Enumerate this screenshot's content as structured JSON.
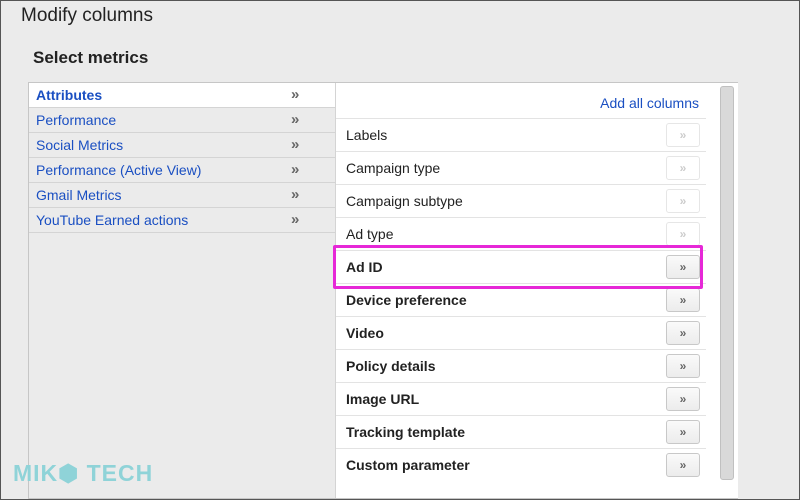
{
  "header": {
    "title": "Modify columns",
    "section_title": "Select metrics"
  },
  "categories": [
    {
      "label": "Attributes",
      "selected": true,
      "arrow": "»"
    },
    {
      "label": "Performance",
      "selected": false,
      "arrow": "»"
    },
    {
      "label": "Social Metrics",
      "selected": false,
      "arrow": "»"
    },
    {
      "label": "Performance (Active View)",
      "selected": false,
      "arrow": "»"
    },
    {
      "label": "Gmail Metrics",
      "selected": false,
      "arrow": "»"
    },
    {
      "label": "YouTube Earned actions",
      "selected": false,
      "arrow": "»"
    }
  ],
  "metrics_panel": {
    "add_all_label": "Add all columns",
    "rows": [
      {
        "label": "Labels",
        "bold": false,
        "disabled": true,
        "button": "»"
      },
      {
        "label": "Campaign type",
        "bold": false,
        "disabled": true,
        "button": "»"
      },
      {
        "label": "Campaign subtype",
        "bold": false,
        "disabled": true,
        "button": "»"
      },
      {
        "label": "Ad type",
        "bold": false,
        "disabled": true,
        "button": "»"
      },
      {
        "label": "Ad ID",
        "bold": true,
        "disabled": false,
        "button": "»"
      },
      {
        "label": "Device preference",
        "bold": true,
        "disabled": false,
        "button": "»"
      },
      {
        "label": "Video",
        "bold": true,
        "disabled": false,
        "button": "»"
      },
      {
        "label": "Policy details",
        "bold": true,
        "disabled": false,
        "button": "»"
      },
      {
        "label": "Image URL",
        "bold": true,
        "disabled": false,
        "button": "»"
      },
      {
        "label": "Tracking template",
        "bold": true,
        "disabled": false,
        "button": "»"
      },
      {
        "label": "Custom parameter",
        "bold": true,
        "disabled": false,
        "button": "»"
      }
    ]
  },
  "watermark": {
    "text": "MIK⬢ TECH"
  },
  "colors": {
    "link": "#1a4fc2",
    "highlight": "#e628d7",
    "watermark": "#8fd3d8"
  }
}
